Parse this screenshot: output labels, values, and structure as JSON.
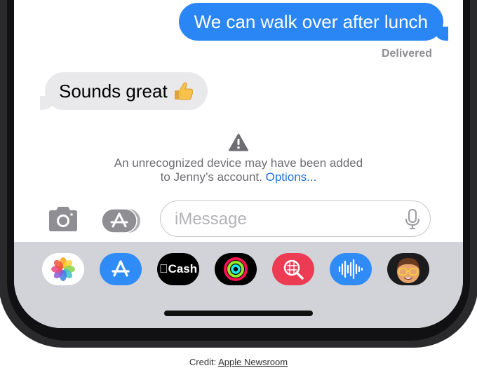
{
  "conversation": {
    "sent_message": "We can walk over after lunch",
    "sent_status": "Delivered",
    "received_message": "Sounds great"
  },
  "security_notice": {
    "line1": "An unrecognized device may have been added",
    "line2_prefix": "to Jenny’s account.",
    "link_label": "Options..."
  },
  "compose": {
    "placeholder": "iMessage"
  },
  "app_drawer": {
    "apps": [
      "photos-icon",
      "app-store-icon",
      "apple-cash-icon",
      "activity-icon",
      "image-search-icon",
      "audio-message-icon",
      "memoji-icon"
    ],
    "cash_label": "Cash"
  },
  "caption": {
    "prefix": "Credit:",
    "link": "Apple Newsroom"
  },
  "colors": {
    "sent_bubble": "#2b86f5",
    "received_bubble": "#e9e9eb",
    "link": "#1f72d9",
    "drawer": "#d1d3d9"
  }
}
